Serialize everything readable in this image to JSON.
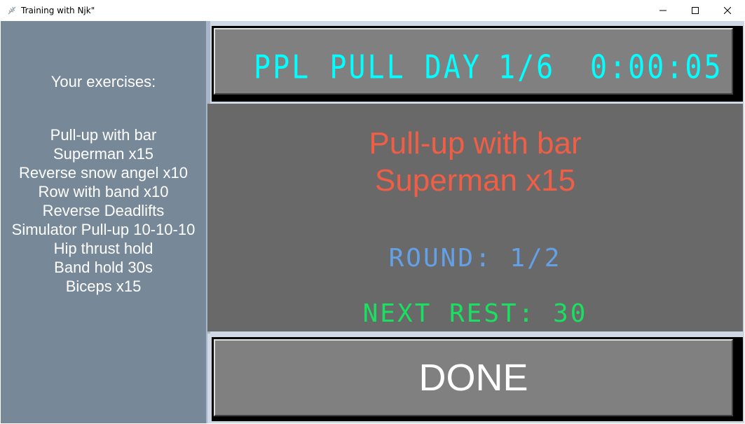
{
  "window": {
    "title": "Training with Njk\"",
    "controls": [
      "minimize",
      "maximize",
      "close"
    ]
  },
  "sidebar": {
    "heading": "Your exercises:",
    "exercises": [
      "Pull-up with bar",
      "Superman x15",
      "Reverse snow angel x10",
      "Row with band x10",
      "Reverse Deadlifts",
      "Simulator Pull-up 10-10-10",
      "Hip thrust hold",
      "Band hold 30s",
      "Biceps x15"
    ]
  },
  "header": {
    "workout_name": "PPL PULL DAY",
    "progress": "1/6",
    "timer": "0:00:05"
  },
  "current": {
    "exercise_1": "Pull-up with bar",
    "exercise_2": "Superman x15",
    "round": "ROUND: 1/2",
    "next_rest": "NEXT REST: 30"
  },
  "actions": {
    "done_label": "DONE"
  },
  "colors": {
    "sidebar_bg": "#778899",
    "panel_bg": "#696969",
    "button_bg": "#808080",
    "lcd_cyan": "#00ffff",
    "exercise_red": "#f05e46",
    "round_blue": "#64a0e6",
    "rest_green": "#19e060"
  }
}
